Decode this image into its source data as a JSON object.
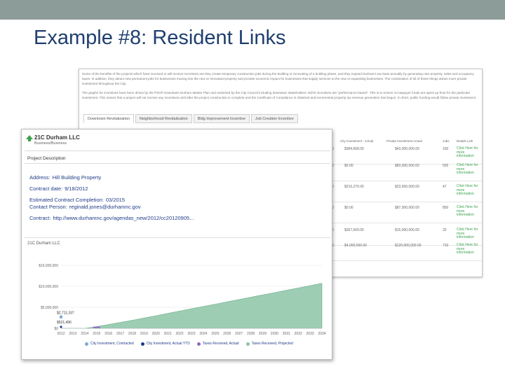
{
  "slide": {
    "title": "Example #8: Resident Links",
    "accent": "#8c9c98",
    "title_color": "#1f3f6e"
  },
  "back": {
    "para1": "Some of the benefits of the projects which have received or will receive incentives are they create temporary construction jobs during the building or renovating of a building phase, and they expand Durham's tax base annually by generating new property, sales and occupancy taxes. In addition, they attract new permanent jobs for businesses moving into the new or renovated property and provide economic impact for businesses that supply services to the new or expanding businesses. The combination of all of these things attract more private investment throughout the City.",
    "para2": "The graphs for incentives have been driven by the PSGP Downtown Durham Master Plan and endorsed by the City Council including downtown stakeholders. NDTs incentives are \"performance-based\". This is to ensure no taxpayer funds are spent up front for the particular investment. This means that a project will not receive any incentives until after the project construction is complete and the Certificate of Compliance is obtained and incremental property tax revenue generation has begun. In short, public funding would follow private investment.",
    "tabs": [
      "Downtown Revitalization",
      "Neighborhood Revitalization",
      "Bldg Improvement Incentive",
      "Job Creation Incentive"
    ],
    "headers": [
      "City Investment - Actual",
      "Private Investment Actual",
      "Jobs",
      "Details Link"
    ],
    "rows": [
      {
        "lead": "0",
        "city": "$384,668.00",
        "private": "$43,000,000.00",
        "jobs": "150",
        "link": "Click Here for more information"
      },
      {
        "lead": "0",
        "city": "$0.00",
        "private": "$83,000,000.00",
        "jobs": "555",
        "link": "Click Here for more information"
      },
      {
        "lead": "0",
        "city": "$215,275.00",
        "private": "$23,000,000.00",
        "jobs": "47",
        "link": "Click Here for more information"
      },
      {
        "lead": "0",
        "city": "$0.00",
        "private": "$87,000,000.00",
        "jobs": "850",
        "link": "Click Here for more information"
      },
      {
        "lead": "0",
        "city": "$367,500.00",
        "private": "$15,000,000.00",
        "jobs": "32",
        "link": "Click Here for more information"
      },
      {
        "lead": "0",
        "city": "$4,000,000.00",
        "private": "$120,000,000.00",
        "jobs": "710",
        "link": "Click Here for more information"
      }
    ],
    "link_color": "#3aa34a"
  },
  "popup": {
    "company": "21C Durham LLC",
    "subtitle": "Business/Business",
    "section": "Project Description",
    "fields": [
      {
        "label": "Address:",
        "value": "Hill Building Property"
      },
      {
        "label": "Contract date:",
        "value": "9/18/2012"
      },
      {
        "label": "Estimated Contract Completion:",
        "value": "03/2015"
      },
      {
        "label": "Contact Person:",
        "value": "reginald.jones@durhamnc.gov"
      },
      {
        "label": "Contract:",
        "value": "http://www.durhamnc.gov/agendas_new/2012/cc20120905..."
      }
    ],
    "field_color": "#1f3c88"
  },
  "chart_data": {
    "type": "area",
    "title": "21C Durham LLC",
    "x": [
      "2012",
      "2013",
      "2014",
      "2015",
      "2016",
      "2017",
      "2018",
      "2019",
      "2020",
      "2021",
      "2022",
      "2023",
      "2024",
      "2025",
      "2026",
      "2027",
      "2028",
      "2029",
      "2030",
      "2031",
      "2032",
      "2033",
      "2034"
    ],
    "yticks": [
      "$0",
      "$5,000,000",
      "$10,000,000",
      "$15,000,000"
    ],
    "ylim": [
      0,
      15000000
    ],
    "series": [
      {
        "name": "City Investment, Contracted",
        "color": "#7fa8d6",
        "points": [
          {
            "x": "2012",
            "y": 2711337
          }
        ]
      },
      {
        "name": "City Investment, Actual YTD",
        "color": "#1f3c88",
        "points": [
          {
            "x": "2012",
            "y": 0
          }
        ]
      },
      {
        "name": "Taxes Received, Actual",
        "color": "#8f6cc7",
        "values": [
          0,
          0,
          0,
          400000,
          0,
          0,
          0,
          0,
          0,
          0,
          0,
          0,
          0,
          0,
          0,
          0,
          0,
          0,
          0,
          0,
          0,
          0,
          0
        ]
      },
      {
        "name": "Taxes Received, Projected",
        "color": "#8cc4a6",
        "values": [
          0,
          0,
          0,
          400000,
          900000,
          1400000,
          1900000,
          2450000,
          3000000,
          3550000,
          4100000,
          4650000,
          5200000,
          5750000,
          6300000,
          6850000,
          7400000,
          7950000,
          8500000,
          9050000,
          9600000,
          10150000,
          10700000
        ]
      }
    ],
    "annotations": [
      "$2,711,337",
      "$521,496"
    ],
    "grid": true,
    "legend": "bottom"
  }
}
